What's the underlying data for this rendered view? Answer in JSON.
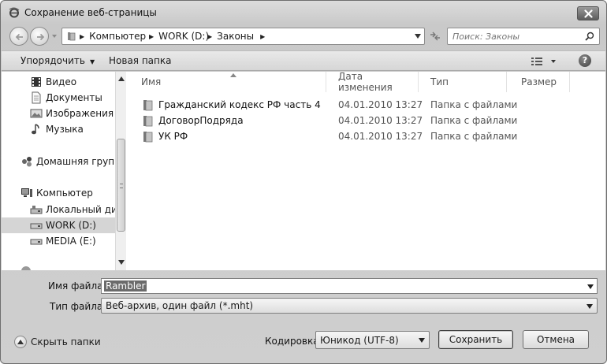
{
  "window": {
    "title": "Сохранение веб-страницы"
  },
  "address": {
    "crumbs": [
      "Компьютер",
      "WORK (D:)",
      "Законы"
    ]
  },
  "search": {
    "placeholder": "Поиск: Законы"
  },
  "toolbar": {
    "organize_label": "Упорядочить",
    "new_folder_label": "Новая папка"
  },
  "nav_pane": {
    "items": [
      {
        "label": "Видео",
        "icon": "video-icon"
      },
      {
        "label": "Документы",
        "icon": "documents-icon"
      },
      {
        "label": "Изображения",
        "icon": "images-icon"
      },
      {
        "label": "Музыка",
        "icon": "music-icon"
      },
      {
        "label": "Домашняя группа",
        "icon": "homegroup-icon"
      },
      {
        "label": "Компьютер",
        "icon": "computer-icon"
      },
      {
        "label": "Локальный диск",
        "icon": "drive-icon"
      },
      {
        "label": "WORK (D:)",
        "icon": "drive-icon",
        "selected": true
      },
      {
        "label": "MEDIA (E:)",
        "icon": "drive-icon"
      }
    ]
  },
  "files": {
    "columns": [
      "Имя",
      "Дата изменения",
      "Тип",
      "Размер"
    ],
    "rows": [
      {
        "name": "Гражданский кодекс РФ часть 4",
        "date": "04.01.2010 13:27",
        "type": "Папка с файлами"
      },
      {
        "name": "ДоговорПодряда",
        "date": "04.01.2010 13:27",
        "type": "Папка с файлами"
      },
      {
        "name": "УК РФ",
        "date": "04.01.2010 13:27",
        "type": "Папка с файлами"
      }
    ]
  },
  "form": {
    "filename_label": "Имя файла:",
    "filename_value": "Rambler",
    "filetype_label": "Тип файла:",
    "filetype_value": "Веб-архив, один файл  (*.mht)",
    "encoding_label": "Кодировка:",
    "encoding_value": "Юникод (UTF-8)"
  },
  "footer": {
    "hide_folders_label": "Скрыть папки",
    "save_label": "Сохранить",
    "cancel_label": "Отмена"
  }
}
